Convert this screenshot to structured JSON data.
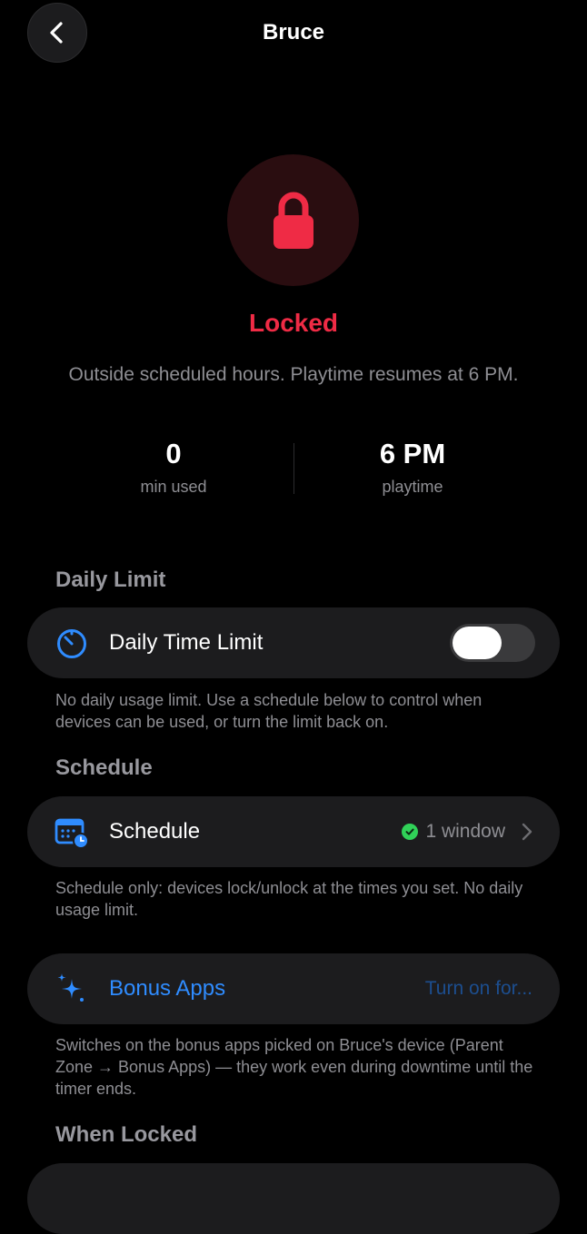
{
  "nav": {
    "title": "Bruce"
  },
  "status": {
    "title": "Locked",
    "description": "Outside scheduled hours. Playtime resumes at 6 PM."
  },
  "stats": [
    {
      "value": "0",
      "label": "min used"
    },
    {
      "value": "6 PM",
      "label": "playtime"
    }
  ],
  "daily_limit": {
    "section_title": "Daily Limit",
    "row_label": "Daily Time Limit",
    "toggle_on": false,
    "footnote": "No daily usage limit. Use a schedule below to control when devices can be used, or turn the limit back on."
  },
  "schedule": {
    "section_title": "Schedule",
    "row_label": "Schedule",
    "count": "1 window",
    "footnote": "Schedule only: devices lock/unlock at the times you set. No daily usage limit."
  },
  "bonus": {
    "row_label": "Bonus Apps",
    "action": "Turn on for...",
    "footnote": "Switches on the bonus apps picked on Bruce's device (Parent Zone → Bonus Apps) — they work even during downtime until the timer ends."
  },
  "when_locked": {
    "section_title": "When Locked"
  },
  "colors": {
    "accent_red": "#ef2b45",
    "accent_blue": "#2f8cff",
    "success_green": "#30d158",
    "card_bg": "#1c1c1e"
  },
  "icons": {
    "back": "chevron-left-icon",
    "lock": "lock-icon",
    "timer": "timer-icon",
    "calendar": "calendar-clock-icon",
    "check": "check-circle-icon",
    "chevron": "chevron-right-icon",
    "sparkles": "sparkles-icon"
  }
}
